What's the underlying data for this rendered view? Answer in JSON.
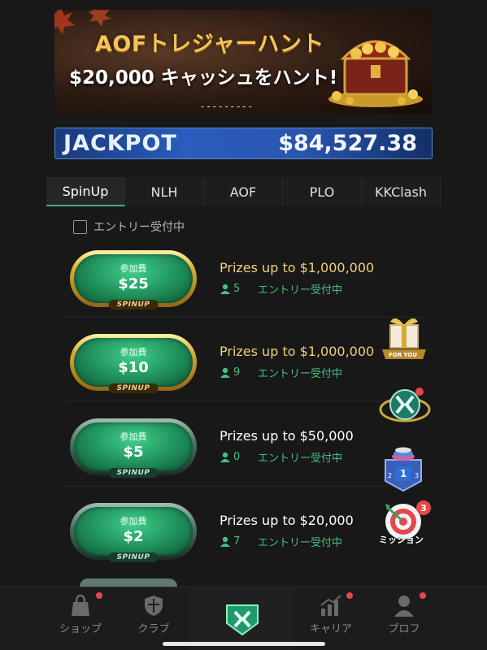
{
  "banner": {
    "title": "AOFトレジャーハント",
    "subtitle": "$20,000 キャッシュをハント!",
    "code": "---------"
  },
  "jackpot": {
    "label": "JACKPOT",
    "value": "$84,527.38"
  },
  "tabs": [
    {
      "label": "SpinUp",
      "active": true
    },
    {
      "label": "NLH"
    },
    {
      "label": "AOF"
    },
    {
      "label": "PLO"
    },
    {
      "label": "KKClash"
    }
  ],
  "filter": {
    "label": "エントリー受付中",
    "checked": false
  },
  "tournaments": [
    {
      "fee_label": "参加費",
      "price": "$25",
      "tag": "SPINUP",
      "style": "gold",
      "prize": "Prizes up to $1,000,000",
      "players": "5",
      "status": "エントリー受付中"
    },
    {
      "fee_label": "参加費",
      "price": "$10",
      "tag": "SPINUP",
      "style": "gold",
      "prize": "Prizes up to $1,000,000",
      "players": "9",
      "status": "エントリー受付中"
    },
    {
      "fee_label": "参加費",
      "price": "$5",
      "tag": "SPINUP",
      "style": "silver",
      "prize": "Prizes up to $50,000",
      "players": "0",
      "status": "エントリー受付中"
    },
    {
      "fee_label": "参加費",
      "price": "$2",
      "tag": "SPINUP",
      "style": "silver",
      "prize": "Prizes up to $20,000",
      "players": "7",
      "status": "エントリー受付中"
    }
  ],
  "floating": {
    "gift_label": "FOR YOU",
    "rank_number": "1",
    "rank_left": "2",
    "rank_right": "3",
    "mission_label": "ミッション",
    "mission_badge": "3"
  },
  "bottom_nav": {
    "shop": "ショップ",
    "club": "クラブ",
    "career": "キャリア",
    "profile": "プロフ"
  },
  "colors": {
    "accent_green": "#3fae7a",
    "gold": "#f0cf79",
    "badge_red": "#e44848",
    "jackpot_blue": "#2a5dbe"
  }
}
